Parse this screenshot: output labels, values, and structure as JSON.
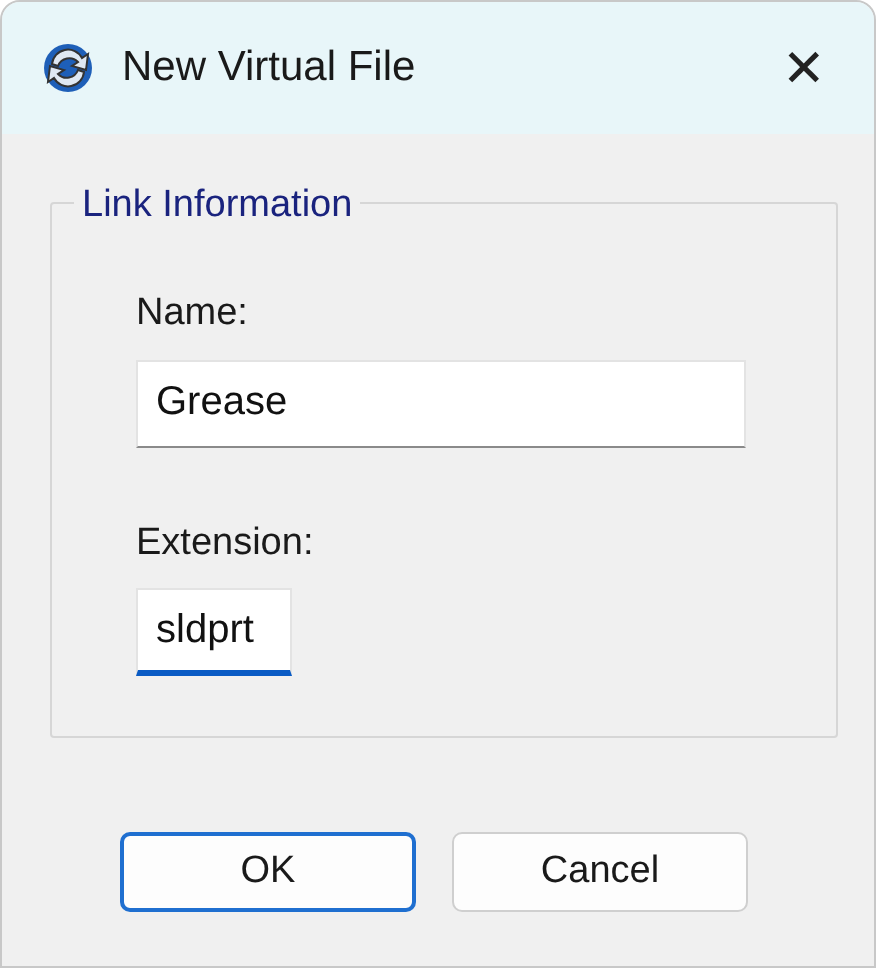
{
  "window": {
    "title": "New Virtual File",
    "close": "✕"
  },
  "group": {
    "title": "Link Information"
  },
  "fields": [
    {
      "label": "Name:",
      "value": "Grease",
      "focused": false,
      "kind": "wide"
    },
    {
      "label": "Extension:",
      "value": "sldprt",
      "focused": true,
      "kind": "narrow"
    }
  ],
  "buttons": [
    {
      "label": "OK",
      "default": true
    },
    {
      "label": "Cancel",
      "default": false
    }
  ]
}
